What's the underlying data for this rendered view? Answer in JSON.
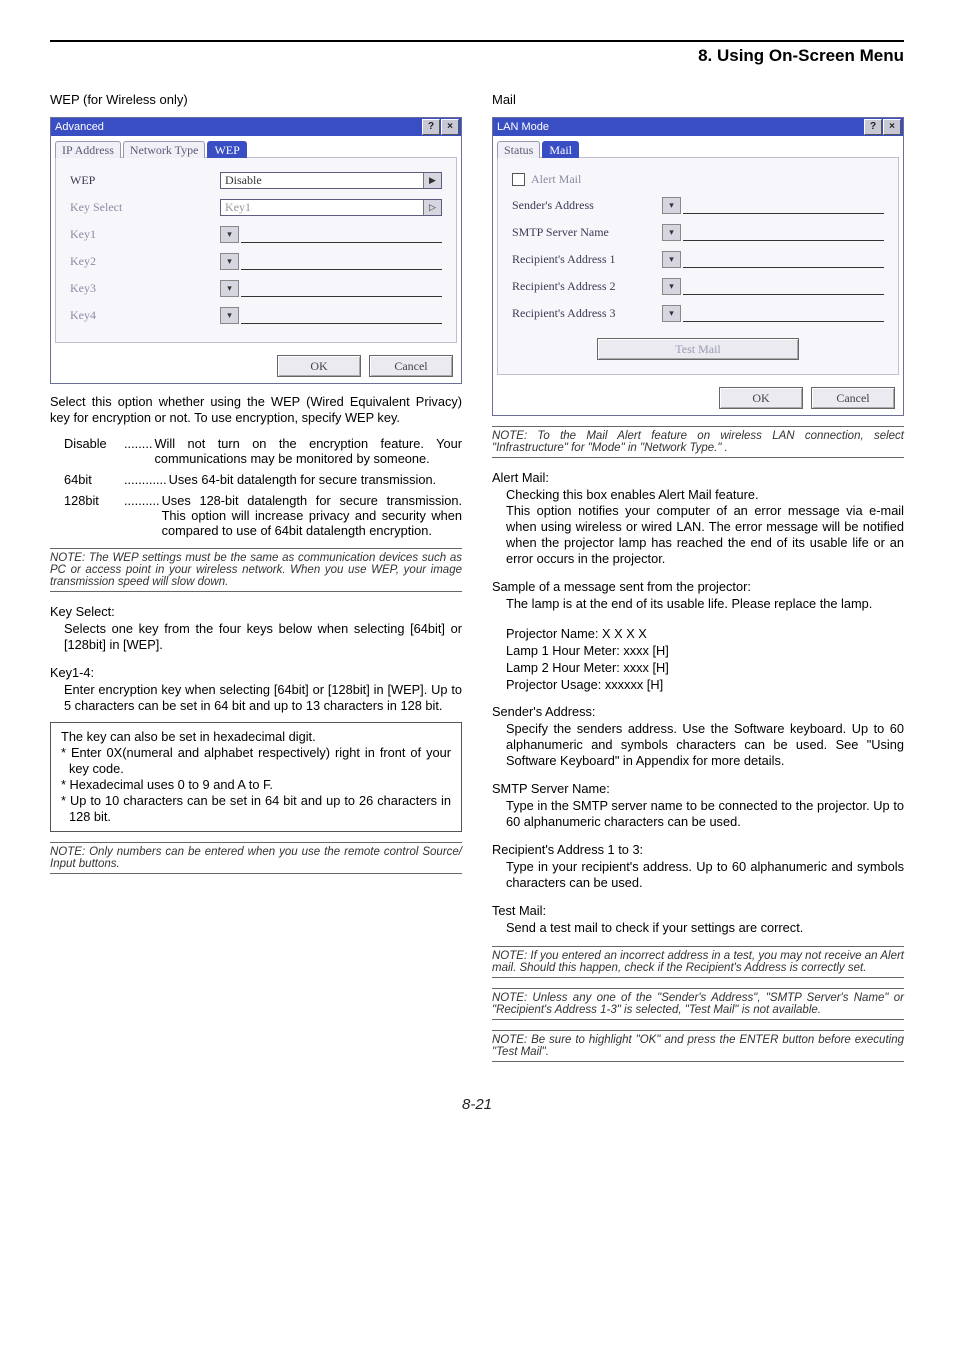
{
  "header": {
    "title": "8. Using On-Screen Menu"
  },
  "left": {
    "section_label": "WEP (for Wireless only)",
    "dialog": {
      "title": "Advanced",
      "tabs": [
        "IP Address",
        "Network Type",
        "WEP"
      ],
      "active_tab": "WEP",
      "wep_label": "WEP",
      "wep_value": "Disable",
      "keyselect_label": "Key Select",
      "keyselect_value": "Key1",
      "key1_label": "Key1",
      "key2_label": "Key2",
      "key3_label": "Key3",
      "key4_label": "Key4",
      "ok": "OK",
      "cancel": "Cancel"
    },
    "intro": "Select this option whether using the WEP (Wired Equivalent Privacy) key for encryption or not. To use encryption, specify WEP key.",
    "items": {
      "disable_label": "Disable",
      "disable_dots": " ........",
      "disable_desc": "Will not turn on the encryption feature. Your communications may be monitored by someone.",
      "b64_label": "64bit",
      "b64_dots": " ............",
      "b64_desc": "Uses 64-bit datalength for secure transmission.",
      "b128_label": "128bit",
      "b128_dots": " ..........",
      "b128_desc": "Uses 128-bit datalength for secure transmission. This option will increase privacy and security when compared to use of 64bit datalength encryption."
    },
    "note": "NOTE: The WEP settings must be the same as communication devices such as PC or access point in your wireless network. When you use WEP, your image transmission speed will slow down.",
    "keyselect_head": "Key Select:",
    "keyselect_body": "Selects one key from the four keys below when selecting [64bit] or [128bit] in [WEP].",
    "key14_head": "Key1-4:",
    "key14_body": "Enter encryption key when selecting [64bit] or [128bit] in [WEP]. Up to 5 characters can be set in 64 bit and up to 13 characters in 128 bit.",
    "hex": {
      "l1": "The key can also be set in hexadecimal digit.",
      "l2": "* Enter 0X(numeral and alphabet respectively) right in front of your key code.",
      "l3": "* Hexadecimal uses 0 to 9 and A to F.",
      "l4": "* Up to 10 characters can be set in 64 bit and up to 26 characters in 128 bit."
    },
    "note2": "NOTE: Only numbers can be entered when you use the remote control Source/ Input buttons."
  },
  "right": {
    "section_label": "Mail",
    "dialog": {
      "title": "LAN Mode",
      "tabs": [
        "Status",
        "Mail"
      ],
      "active_tab": "Mail",
      "alert_label": "Alert Mail",
      "sender_label": "Sender's Address",
      "smtp_label": "SMTP Server Name",
      "r1_label": "Recipient's Address 1",
      "r2_label": "Recipient's Address 2",
      "r3_label": "Recipient's Address 3",
      "test_label": "Test Mail",
      "ok": "OK",
      "cancel": "Cancel"
    },
    "note_top": "NOTE: To the Mail Alert feature on wireless LAN connection, select \"Infrastructure\" for \"Mode\" in \"Network Type.\" .",
    "alert_head": "Alert Mail:",
    "alert_body": "Checking this box enables Alert Mail feature.\nThis option notifies your computer of an error message via e-mail when using wireless or wired LAN. The error message will be notified when the projector lamp has reached the end of its usable life or an error occurs in the projector.",
    "sample_head": "Sample of a message sent from the projector:",
    "sample_body": "The lamp is at the end of its usable life. Please replace the lamp.",
    "sample_lines": {
      "l1": "Projector Name: X X X X",
      "l2": "Lamp 1 Hour Meter: xxxx [H]",
      "l3": "Lamp 2 Hour Meter: xxxx [H]",
      "l4": "Projector Usage: xxxxxx [H]"
    },
    "sender_head": "Sender's Address:",
    "sender_body": "Specify the senders address. Use the Software keyboard. Up to 60 alphanumeric and symbols characters can be used. See \"Using Software Keyboard\" in Appendix for more details.",
    "smtp_head": "SMTP Server Name:",
    "smtp_body": "Type in the SMTP server name to be connected to the projector. Up to 60 alphanumeric characters can be used.",
    "rcpt_head": "Recipient's Address 1 to 3:",
    "rcpt_body": "Type in your recipient's address. Up to 60 alphanumeric and symbols characters can be used.",
    "test_head": "Test Mail:",
    "test_body": "Send a test mail to check if your settings are correct.",
    "note1": "NOTE: If you entered an incorrect address in a test, you may not receive an Alert mail. Should this happen, check if the Recipient's Address is correctly set.",
    "note2": "NOTE: Unless any one of the \"Sender's Address\", \"SMTP Server's Name\" or \"Recipient's Address 1-3\" is selected, \"Test Mail\" is not available.",
    "note3": "NOTE: Be sure to highlight \"OK\" and press the ENTER button before executing \"Test Mail\"."
  },
  "page_number": "8-21"
}
